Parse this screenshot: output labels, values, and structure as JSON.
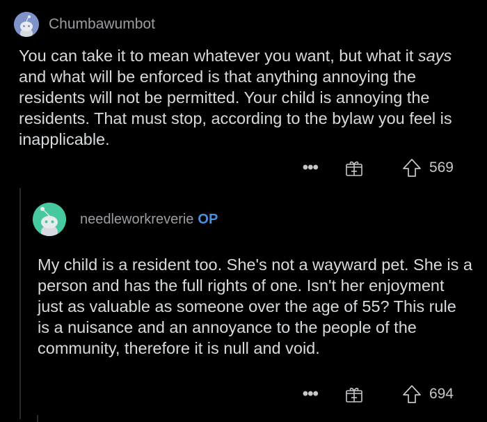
{
  "comments": [
    {
      "username": "Chumbawumbot",
      "op_badge": "",
      "text_before": "You can take it to mean whatever you want, but what it ",
      "text_emphasis": "says",
      "text_after": " and what will be enforced is that anything annoying the residents will not be permitted. Your child is annoying the residents. That must stop, according to the bylaw you feel is inapplicable.",
      "more_label": "•••",
      "score": "569",
      "avatar_color": "#7f92c9"
    },
    {
      "username": "needleworkreverie",
      "op_badge": "OP",
      "text": "My child is a resident too. She's not a wayward pet. She is a person and has the full rights of one. Isn't her enjoyment just as valuable as someone over the age of 55? This rule is a nuisance and an annoyance to the people of the community, therefore it is null and void.",
      "more_label": "•••",
      "score": "694",
      "avatar_color": "#46c9a0"
    }
  ],
  "colors": {
    "background": "#000000",
    "text": "#d7dadc",
    "muted": "#9a9ea2",
    "op": "#4a90e2"
  },
  "icons": [
    "snoo-avatar-icon",
    "more-options-icon",
    "gift-award-icon",
    "upvote-arrow-icon"
  ]
}
